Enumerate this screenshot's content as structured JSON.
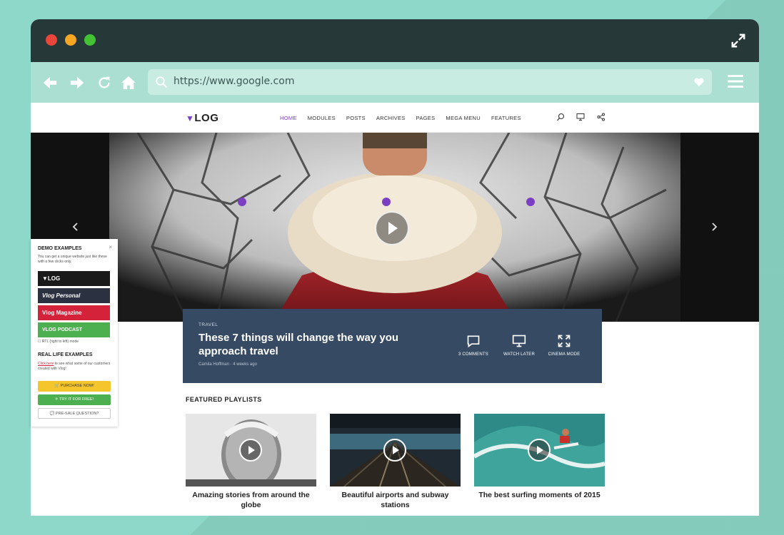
{
  "browser": {
    "url": "https://www.google.com"
  },
  "site": {
    "logo": "LOG",
    "nav": [
      "HOME",
      "MODULES",
      "POSTS",
      "ARCHIVES",
      "PAGES",
      "MEGA MENU",
      "FEATURES"
    ]
  },
  "post": {
    "category": "TRAVEL",
    "title": "These 7 things will change the way you approach travel",
    "author": "Camila Hoffman",
    "date": "4 weeks ago",
    "actions": {
      "comments": "3 COMMENTS",
      "watch_later": "WATCH LATER",
      "cinema_mode": "CINEMA MODE"
    }
  },
  "featured": {
    "title": "FEATURED PLAYLISTS",
    "cards": [
      {
        "title": "Amazing stories from around the globe"
      },
      {
        "title": "Beautiful airports and subway stations"
      },
      {
        "title": "The best surfing moments of 2015"
      }
    ]
  },
  "demo": {
    "heading": "DEMO EXAMPLES",
    "text": "You can get a unique website just like these with a few clicks only.",
    "close": "×",
    "thumbs": [
      "▼LOG",
      "Vlog Personal",
      "Vlog Magazine",
      "VLOG PODCAST"
    ],
    "rtl": "RTL (right to left) mode",
    "real_heading": "REAL LIFE EXAMPLES",
    "real_link": "Click here",
    "real_text": " to see what some of our customers created with Vlog!",
    "purchase": "PURCHASE NOW!",
    "try": "TRY IT FOR FREE!",
    "presale": "PRE-SALE QUESTION?"
  },
  "colors": {
    "background": "#8dd8c8",
    "titlebar": "#263838",
    "toolbar": "#aadfd2",
    "accent": "#7b3fc4",
    "post_box": "#364a63"
  }
}
